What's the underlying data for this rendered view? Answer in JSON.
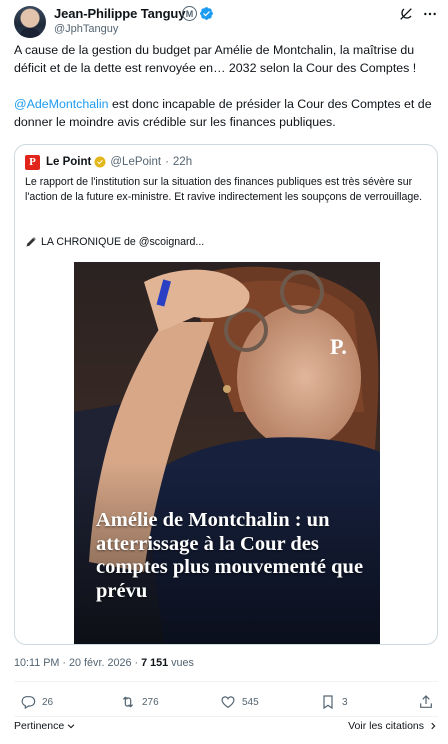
{
  "author": {
    "name": "Jean-Philippe Tanguy",
    "handle": "@JphTanguy",
    "badge_letter": "M"
  },
  "tweet": {
    "paragraph1": "A cause de la gestion du budget par Amélie de Montchalin, la maîtrise du déficit et de la dette est renvoyée en… 2032 selon la Cour des Comptes !",
    "mention": "@AdeMontchalin",
    "paragraph2_rest": " est donc incapable de présider la Cour des Comptes et de donner le moindre avis crédible sur les finances publiques."
  },
  "quote": {
    "logo_letter": "P",
    "name": "Le Point",
    "handle": "@LePoint",
    "separator": "·",
    "time": "22h",
    "text": "Le rapport de l'institution sur la situation des finances publiques est très sévère sur l'action de la future ex-ministre. Et ravive indirectement les soupçons de verrouillage.",
    "chronique": "LA CHRONIQUE de @scoignard...",
    "image_headline": "Amélie de Montchalin : un atterrissage à la Cour des comptes plus mouvementé que prévu",
    "image_watermark": "P."
  },
  "meta": {
    "time": "10:11 PM",
    "date": "20 févr. 2026",
    "separator": "·",
    "views_count": "7 151",
    "views_label": "vues"
  },
  "actions": {
    "replies": "26",
    "reposts": "276",
    "likes": "545",
    "bookmarks": "3"
  },
  "footer": {
    "sort_label": "Pertinence",
    "citations_label": "Voir les citations"
  },
  "colors": {
    "accent": "#1d9bf0",
    "text": "#0f1419",
    "muted": "#536471",
    "le_point_red": "#e1251b"
  }
}
